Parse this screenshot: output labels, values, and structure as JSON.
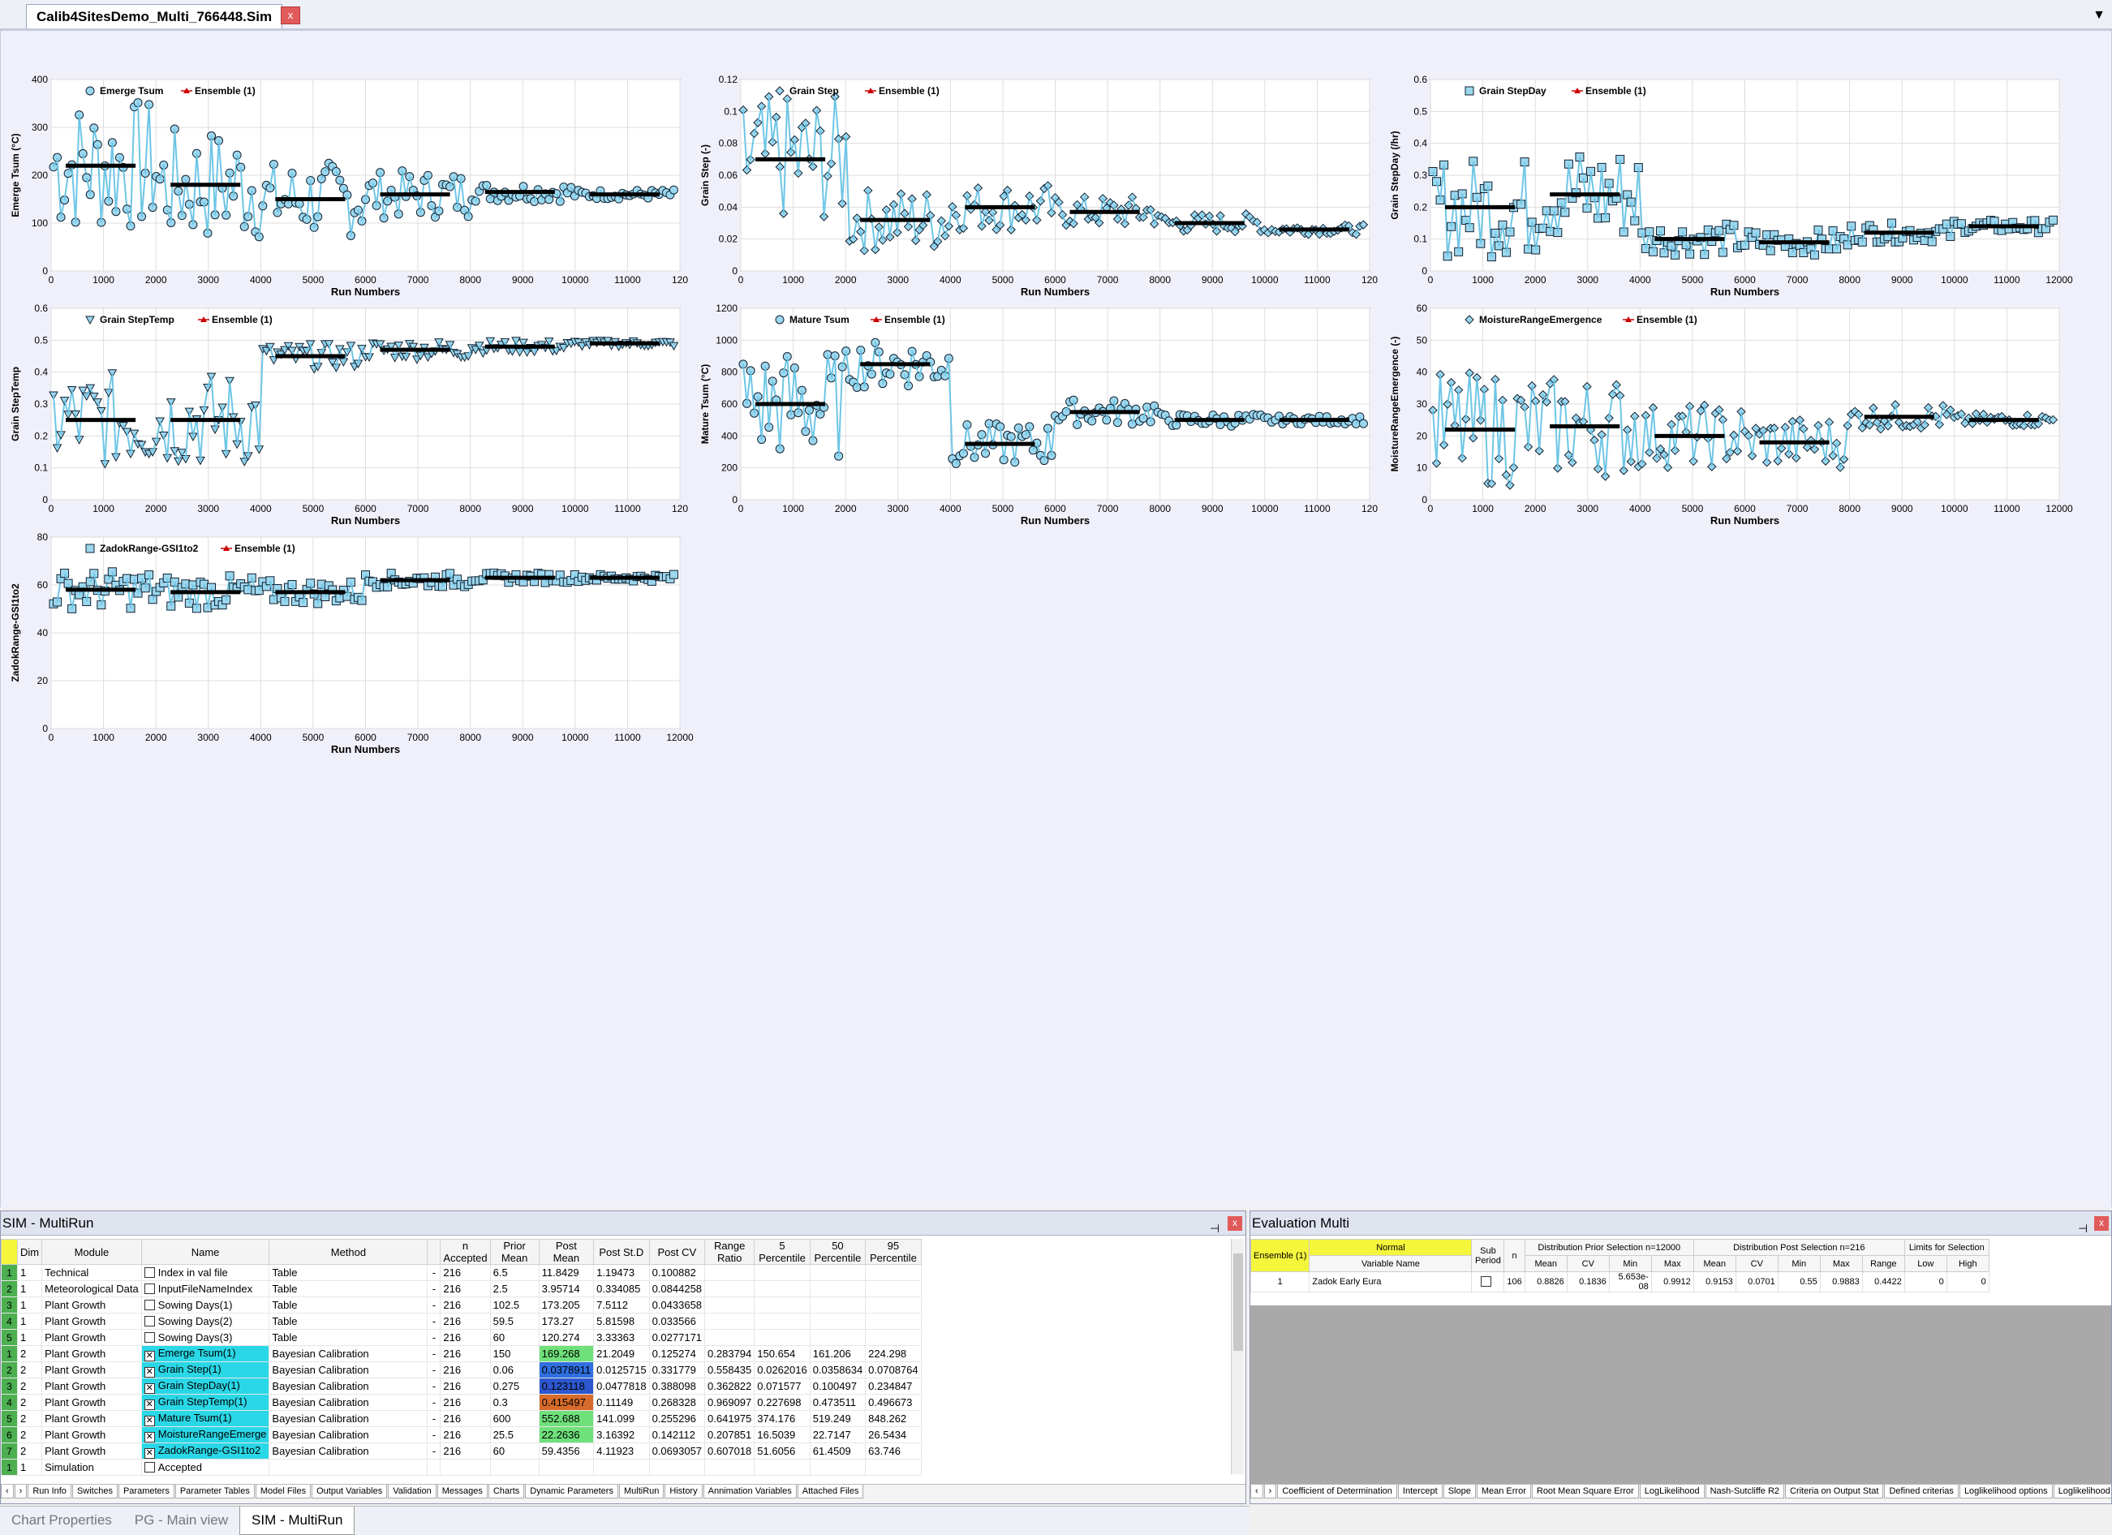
{
  "window": {
    "doc_tab": "Calib4SitesDemo_Multi_766448.Sim",
    "close": "x",
    "menu": "▼"
  },
  "charts": [
    {
      "legend": "Emerge Tsum",
      "ylabel": "Emerge Tsum (°C)",
      "xlabel": "Run Numbers",
      "marker": "circle",
      "ymin": 0,
      "ymax": 400,
      "yticks": [
        0,
        100,
        200,
        300,
        400
      ],
      "xticks": [
        0,
        1000,
        2000,
        3000,
        4000,
        5000,
        6000,
        7000,
        8000,
        9000,
        10000,
        11000,
        "120"
      ],
      "ensemble": "Ensemble (1)",
      "center": [
        220,
        180,
        150,
        160,
        165,
        160
      ],
      "spread": [
        140,
        120,
        80,
        50,
        20,
        10
      ]
    },
    {
      "legend": "Grain Step",
      "ylabel": "Grain Step (-)",
      "xlabel": "Run Numbers",
      "marker": "diamond",
      "ymin": 0,
      "ymax": 0.12,
      "yticks": [
        0,
        0.02,
        0.04,
        0.06,
        0.08,
        0.1,
        0.12
      ],
      "xticks": [
        0,
        1000,
        2000,
        3000,
        4000,
        5000,
        6000,
        7000,
        8000,
        9000,
        10000,
        11000,
        "120"
      ],
      "ensemble": "Ensemble (1)",
      "center": [
        0.07,
        0.032,
        0.04,
        0.037,
        0.03,
        0.026
      ],
      "spread": [
        0.04,
        0.02,
        0.015,
        0.01,
        0.006,
        0.003
      ]
    },
    {
      "legend": "Grain StepDay",
      "ylabel": "Grain StepDay (/hr)",
      "xlabel": "Run Numbers",
      "marker": "square",
      "ymin": 0,
      "ymax": 0.6,
      "yticks": [
        0,
        0.1,
        0.2,
        0.3,
        0.4,
        0.5,
        0.6
      ],
      "xticks": [
        0,
        1000,
        2000,
        3000,
        4000,
        5000,
        6000,
        7000,
        8000,
        9000,
        10000,
        11000,
        12000
      ],
      "ensemble": "Ensemble (1)",
      "center": [
        0.2,
        0.24,
        0.1,
        0.09,
        0.12,
        0.14
      ],
      "spread": [
        0.16,
        0.15,
        0.05,
        0.04,
        0.03,
        0.02
      ]
    },
    {
      "legend": "Grain StepTemp",
      "ylabel": "Grain StepTemp",
      "xlabel": "Run Numbers",
      "marker": "triangle",
      "ymin": 0,
      "ymax": 0.6,
      "yticks": [
        0,
        0.1,
        0.2,
        0.3,
        0.4,
        0.5,
        0.6
      ],
      "xticks": [
        0,
        1000,
        2000,
        3000,
        4000,
        5000,
        6000,
        7000,
        8000,
        9000,
        10000,
        11000,
        "120"
      ],
      "ensemble": "Ensemble (1)",
      "center": [
        0.25,
        0.25,
        0.45,
        0.47,
        0.48,
        0.49
      ],
      "spread": [
        0.15,
        0.15,
        0.04,
        0.03,
        0.02,
        0.01
      ]
    },
    {
      "legend": "Mature Tsum",
      "ylabel": "Mature Tsum (°C)",
      "xlabel": "Run Numbers",
      "marker": "circle",
      "ymin": 0,
      "ymax": 1200,
      "yticks": [
        0,
        200,
        400,
        600,
        800,
        1000,
        1200
      ],
      "xticks": [
        0,
        1000,
        2000,
        3000,
        4000,
        5000,
        6000,
        7000,
        8000,
        9000,
        10000,
        11000,
        "120"
      ],
      "ensemble": "Ensemble (1)",
      "center": [
        600,
        850,
        350,
        550,
        500,
        500
      ],
      "spread": [
        350,
        150,
        130,
        80,
        40,
        25
      ]
    },
    {
      "legend": "MoistureRangeEmergence",
      "ylabel": "MoistureRangeEmergence (-)",
      "xlabel": "Run Numbers",
      "marker": "diamond",
      "ymin": 0,
      "ymax": 60,
      "yticks": [
        0,
        10,
        20,
        30,
        40,
        50,
        60
      ],
      "xticks": [
        0,
        1000,
        2000,
        3000,
        4000,
        5000,
        6000,
        7000,
        8000,
        9000,
        10000,
        11000,
        12000
      ],
      "ensemble": "Ensemble (1)",
      "center": [
        22,
        23,
        20,
        18,
        26,
        25
      ],
      "spread": [
        18,
        16,
        10,
        8,
        4,
        2
      ]
    },
    {
      "legend": "ZadokRange-GSI1to2",
      "ylabel": "ZadokRange-GSI1to2",
      "xlabel": "Run Numbers",
      "marker": "square",
      "ymin": 0,
      "ymax": 80,
      "yticks": [
        0,
        20,
        40,
        60,
        80
      ],
      "xticks": [
        0,
        1000,
        2000,
        3000,
        4000,
        5000,
        6000,
        7000,
        8000,
        9000,
        10000,
        11000,
        12000
      ],
      "ensemble": "Ensemble (1)",
      "center": [
        58,
        57,
        57,
        62,
        63,
        63
      ],
      "spread": [
        8,
        7,
        5,
        3,
        2,
        1.5
      ]
    }
  ],
  "multirun": {
    "title": "SIM - MultiRun",
    "pin": "⊣",
    "close": "x",
    "columns": [
      "Dim",
      "Module",
      "Name",
      "Method",
      "",
      "n Accepted",
      "Prior Mean",
      "Post Mean",
      "Post St.D",
      "Post CV",
      "Range Ratio",
      "5 Percentile",
      "50 Percentile",
      "95 Percentile"
    ],
    "rows": [
      {
        "i": "1",
        "dim": "1",
        "module": "Technical",
        "name": "Index in val file",
        "checked": "",
        "method": "Table",
        "dash": "-",
        "n": "216",
        "prior": "6.5",
        "post": "11.8429",
        "std": "1.19473",
        "cv": "0.100882",
        "rr": "",
        "p5": "",
        "p50": "",
        "p95": "",
        "hl": ""
      },
      {
        "i": "2",
        "dim": "1",
        "module": "Meteorological Data",
        "name": "InputFileNameIndex",
        "checked": "",
        "method": "Table",
        "dash": "-",
        "n": "216",
        "prior": "2.5",
        "post": "3.95714",
        "std": "0.334085",
        "cv": "0.0844258",
        "rr": "",
        "p5": "",
        "p50": "",
        "p95": "",
        "hl": ""
      },
      {
        "i": "3",
        "dim": "1",
        "module": "Plant Growth",
        "name": "Sowing Days(1)",
        "checked": "",
        "method": "Table",
        "dash": "-",
        "n": "216",
        "prior": "102.5",
        "post": "173.205",
        "std": "7.5112",
        "cv": "0.0433658",
        "rr": "",
        "p5": "",
        "p50": "",
        "p95": "",
        "hl": ""
      },
      {
        "i": "4",
        "dim": "1",
        "module": "Plant Growth",
        "name": "Sowing Days(2)",
        "checked": "",
        "method": "Table",
        "dash": "-",
        "n": "216",
        "prior": "59.5",
        "post": "173.27",
        "std": "5.81598",
        "cv": "0.033566",
        "rr": "",
        "p5": "",
        "p50": "",
        "p95": "",
        "hl": ""
      },
      {
        "i": "5",
        "dim": "1",
        "module": "Plant Growth",
        "name": "Sowing Days(3)",
        "checked": "",
        "method": "Table",
        "dash": "-",
        "n": "216",
        "prior": "60",
        "post": "120.274",
        "std": "3.33363",
        "cv": "0.0277171",
        "rr": "",
        "p5": "",
        "p50": "",
        "p95": "",
        "hl": ""
      },
      {
        "i": "1",
        "dim": "2",
        "module": "Plant Growth",
        "name": "Emerge Tsum(1)",
        "checked": "✕",
        "method": "Bayesian Calibration",
        "dash": "-",
        "n": "216",
        "prior": "150",
        "post": "169.268",
        "std": "21.2049",
        "cv": "0.125274",
        "rr": "0.283794",
        "p5": "150.654",
        "p50": "161.206",
        "p95": "224.298",
        "hl": "#6fe07a"
      },
      {
        "i": "2",
        "dim": "2",
        "module": "Plant Growth",
        "name": "Grain Step(1)",
        "checked": "✕",
        "method": "Bayesian Calibration",
        "dash": "-",
        "n": "216",
        "prior": "0.06",
        "post": "0.0378911",
        "std": "0.0125715",
        "cv": "0.331779",
        "rr": "0.558435",
        "p5": "0.0262016",
        "p50": "0.0358634",
        "p95": "0.0708764",
        "hl": "#2f6fe0"
      },
      {
        "i": "3",
        "dim": "2",
        "module": "Plant Growth",
        "name": "Grain StepDay(1)",
        "checked": "✕",
        "method": "Bayesian Calibration",
        "dash": "-",
        "n": "216",
        "prior": "0.275",
        "post": "0.123118",
        "std": "0.0477818",
        "cv": "0.388098",
        "rr": "0.362822",
        "p5": "0.071577",
        "p50": "0.100497",
        "p95": "0.234847",
        "hl": "#2d57cf"
      },
      {
        "i": "4",
        "dim": "2",
        "module": "Plant Growth",
        "name": "Grain StepTemp(1)",
        "checked": "✕",
        "method": "Bayesian Calibration",
        "dash": "-",
        "n": "216",
        "prior": "0.3",
        "post": "0.415497",
        "std": "0.11149",
        "cv": "0.268328",
        "rr": "0.969097",
        "p5": "0.227698",
        "p50": "0.473511",
        "p95": "0.496673",
        "hl": "#d66b2b"
      },
      {
        "i": "5",
        "dim": "2",
        "module": "Plant Growth",
        "name": "Mature Tsum(1)",
        "checked": "✕",
        "method": "Bayesian Calibration",
        "dash": "-",
        "n": "216",
        "prior": "600",
        "post": "552.688",
        "std": "141.099",
        "cv": "0.255296",
        "rr": "0.641975",
        "p5": "374.176",
        "p50": "519.249",
        "p95": "848.262",
        "hl": "#6fe07a"
      },
      {
        "i": "6",
        "dim": "2",
        "module": "Plant Growth",
        "name": "MoistureRangeEmerge",
        "checked": "✕",
        "method": "Bayesian Calibration",
        "dash": "-",
        "n": "216",
        "prior": "25.5",
        "post": "22.2636",
        "std": "3.16392",
        "cv": "0.142112",
        "rr": "0.207851",
        "p5": "16.5039",
        "p50": "22.7147",
        "p95": "26.5434",
        "hl": "#6fe07a"
      },
      {
        "i": "7",
        "dim": "2",
        "module": "Plant Growth",
        "name": "ZadokRange-GSI1to2",
        "checked": "✕",
        "method": "Bayesian Calibration",
        "dash": "-",
        "n": "216",
        "prior": "60",
        "post": "59.4356",
        "std": "4.11923",
        "cv": "0.0693057",
        "rr": "0.607018",
        "p5": "51.6056",
        "p50": "61.4509",
        "p95": "63.746",
        "hl": ""
      },
      {
        "i": "1",
        "dim": "1",
        "module": "Simulation",
        "name": "Accepted",
        "checked": "",
        "method": "",
        "dash": "",
        "n": "",
        "prior": "",
        "post": "",
        "std": "",
        "cv": "",
        "rr": "",
        "p5": "",
        "p50": "",
        "p95": "",
        "hl": ""
      }
    ],
    "tabs": [
      "Run Info",
      "Switches",
      "Parameters",
      "Parameter Tables",
      "Model Files",
      "Output Variables",
      "Validation",
      "Messages",
      "Charts",
      "Dynamic Parameters",
      "MultiRun",
      "History",
      "Annimation Variables",
      "Attached Files"
    ]
  },
  "evaluation": {
    "title": "Evaluation Multi",
    "pin": "⊣",
    "close": "x",
    "ensemble": "Ensemble (1)",
    "normal": "Normal",
    "variable_name": "Variable Name",
    "sub_period": "Sub Period",
    "n": "n",
    "prior_group": "Distribution Prior Selection n=12000",
    "post_group": "Distribution Post Selection n=216",
    "limits_group": "Limits for Selection",
    "sub_cols": [
      "Mean",
      "CV",
      "Min",
      "Max",
      "Mean",
      "CV",
      "Min",
      "Max",
      "Range",
      "Low",
      "High"
    ],
    "row": {
      "idx": "1",
      "name": "Zadok Early Eura",
      "n": "106",
      "vals": [
        "0.8826",
        "0.1836",
        "5.653e-08",
        "0.9912",
        "0.9153",
        "0.0701",
        "0.55",
        "0.9883",
        "0.4422",
        "0",
        "0"
      ]
    },
    "tabs": [
      "Coefficient of Determination",
      "Intercept",
      "Slope",
      "Mean Error",
      "Root Mean Square Error",
      "LogLikelihood",
      "Nash-Sutcliffe R2",
      "Criteria on Output Stat",
      "Defined criterias",
      "Loglikelihood options",
      "Loglikelihood statisti"
    ]
  },
  "bottom_tabs": [
    "Chart Properties",
    "PG - Main view",
    "SIM - MultiRun"
  ]
}
